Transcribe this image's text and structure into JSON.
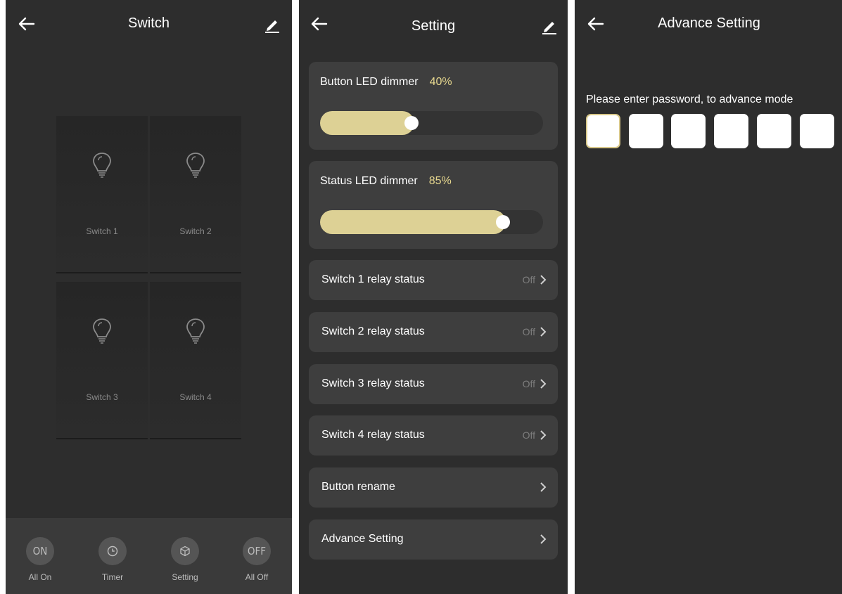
{
  "switch_screen": {
    "title": "Switch",
    "switches": [
      {
        "label": "Switch 1"
      },
      {
        "label": "Switch 2"
      },
      {
        "label": "Switch 3"
      },
      {
        "label": "Switch 4"
      }
    ],
    "bottom_bar": [
      {
        "icon_text": "ON",
        "label": "All On",
        "icon": "on-icon"
      },
      {
        "icon_text": "",
        "label": "Timer",
        "icon": "clock-icon"
      },
      {
        "icon_text": "",
        "label": "Setting",
        "icon": "cube-icon"
      },
      {
        "icon_text": "OFF",
        "label": "All Off",
        "icon": "off-icon"
      }
    ]
  },
  "setting_screen": {
    "title": "Setting",
    "button_led": {
      "label": "Button LED dimmer",
      "value_text": "40%",
      "level": 0.4
    },
    "status_led": {
      "label": "Status LED dimmer",
      "value_text": "85%",
      "level": 0.85
    },
    "rows": [
      {
        "label": "Switch 1 relay status",
        "value": "Off"
      },
      {
        "label": "Switch 2 relay status",
        "value": "Off"
      },
      {
        "label": "Switch 3 relay status",
        "value": "Off"
      },
      {
        "label": "Switch 4 relay status",
        "value": "Off"
      },
      {
        "label": "Button rename",
        "value": ""
      },
      {
        "label": "Advance Setting",
        "value": ""
      }
    ]
  },
  "advance_screen": {
    "title": "Advance Setting",
    "prompt": "Please enter password, to advance mode"
  },
  "colors": {
    "background": "#2d2d2d",
    "card": "#3e3e3e",
    "accent": "#ddd195",
    "accent_text": "#e7d88f"
  }
}
